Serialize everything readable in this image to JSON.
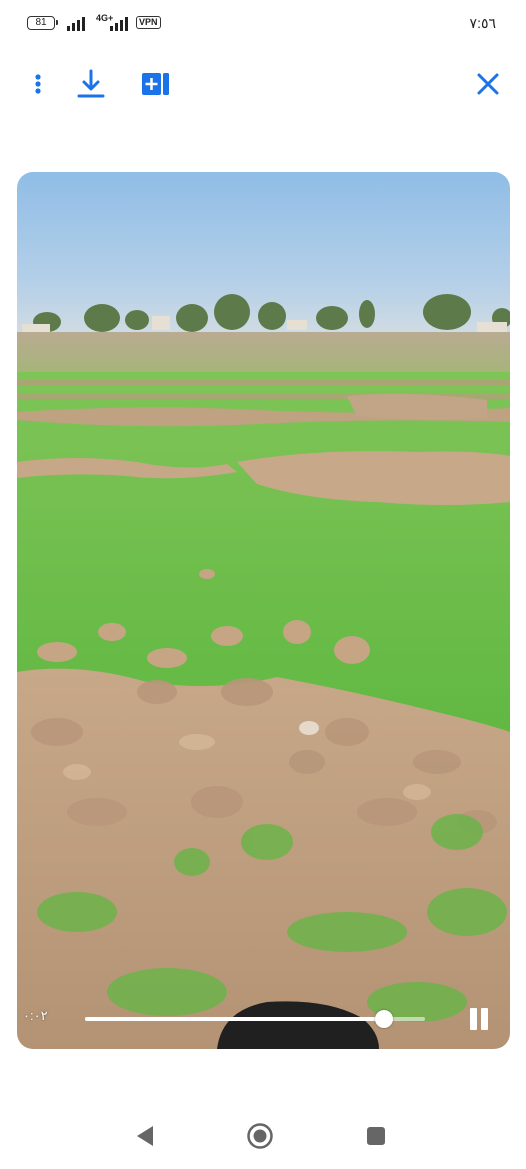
{
  "status_bar": {
    "battery": "81",
    "network": "4G+",
    "vpn": "VPN",
    "time": "٧:٥٦"
  },
  "toolbar": {
    "more_icon": "more-vertical-icon",
    "download_icon": "download-icon",
    "add_to_album_icon": "add-to-album-icon",
    "close_icon": "close-icon",
    "accent_color": "#1a73e8"
  },
  "video": {
    "elapsed": "۰:۰۲",
    "progress_fraction": 0.88,
    "pause_icon": "pause-icon"
  },
  "nav_bar": {
    "back_icon": "back-triangle-icon",
    "home_icon": "home-circle-icon",
    "recents_icon": "recents-square-icon"
  }
}
